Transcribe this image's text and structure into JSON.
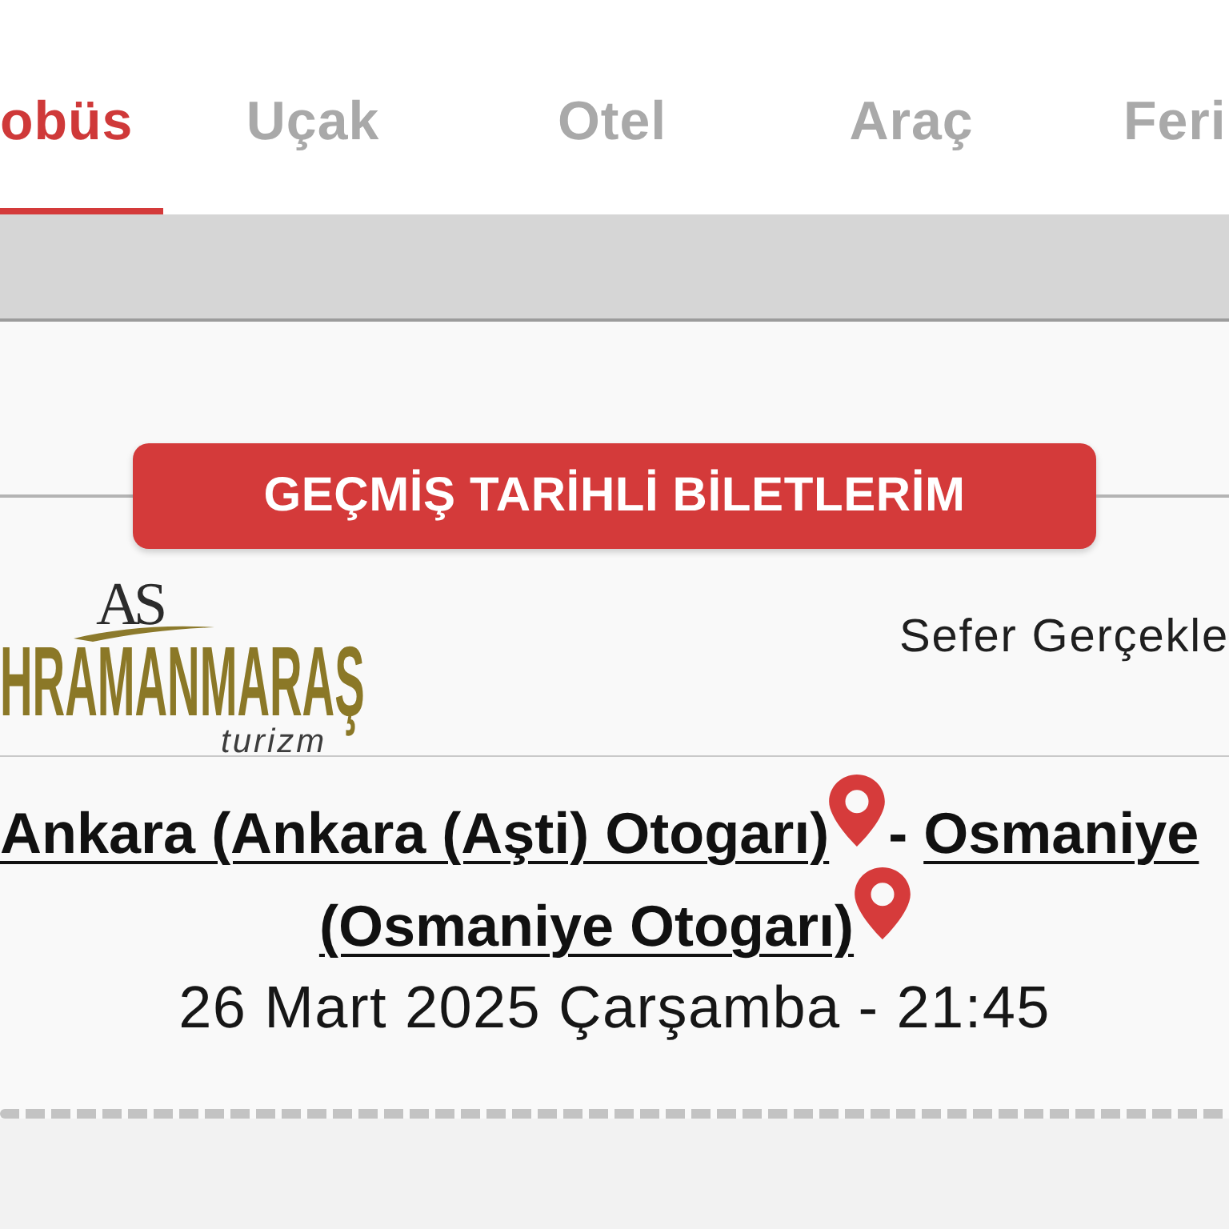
{
  "tabs": [
    {
      "label": "obüs",
      "selected": true
    },
    {
      "label": "Uçak",
      "selected": false
    },
    {
      "label": "Otel",
      "selected": false
    },
    {
      "label": "Araç",
      "selected": false
    },
    {
      "label": "Feri",
      "selected": false
    }
  ],
  "past_tickets_button": {
    "label": "GEÇMİŞ TARİHLİ BİLETLERİM"
  },
  "ticket": {
    "company_logo": {
      "monogram": "AS",
      "wordmark": "HRAMANMARAŞ",
      "tagline": "turizm"
    },
    "status": "Sefer Gerçekle",
    "route": {
      "origin": "Ankara (Ankara (Aşti) Otogarı)",
      "separator": "-",
      "destination": {
        "city": "Osmaniye",
        "terminal": "(Osmaniye Otogarı)"
      }
    },
    "departure": "26 Mart 2025 Çarşamba - 21:45"
  }
}
